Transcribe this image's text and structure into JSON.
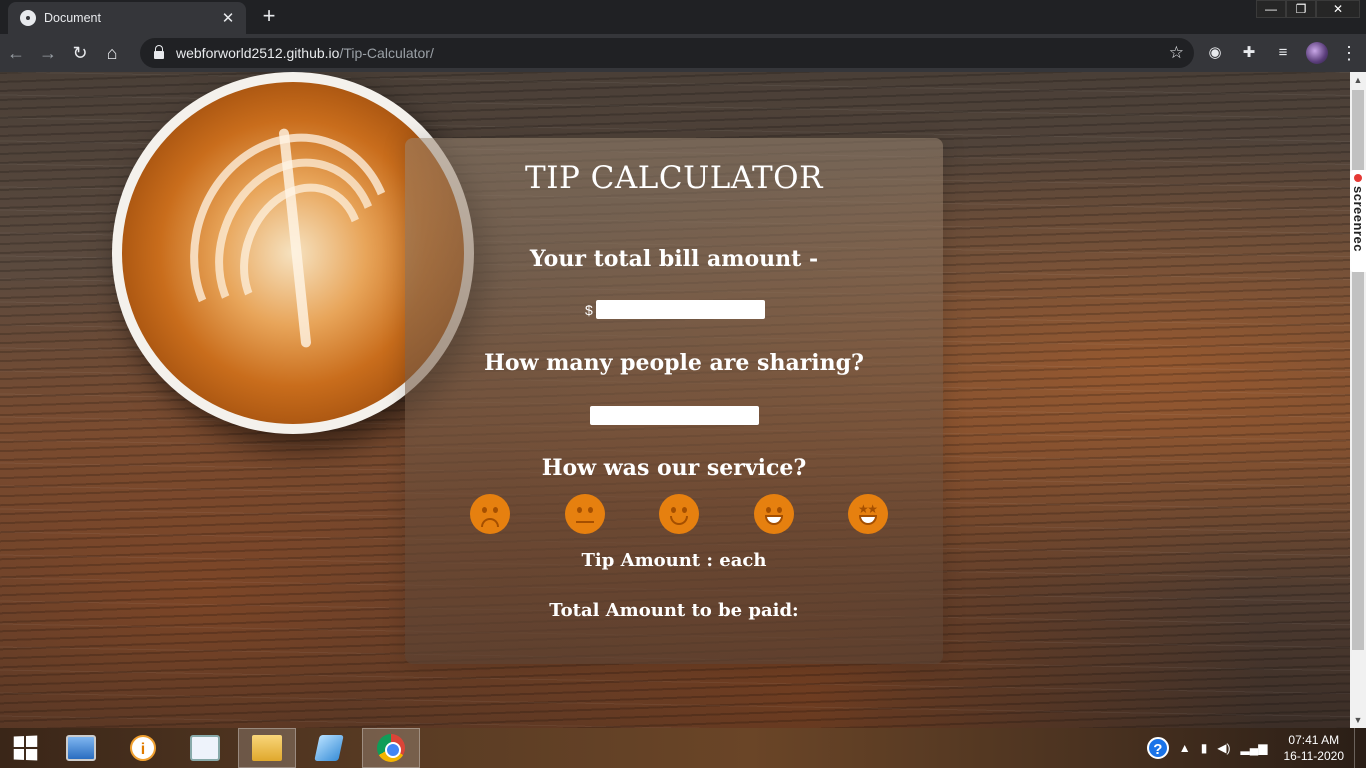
{
  "browser": {
    "tab_title": "Document",
    "tab_close": "✕",
    "new_tab": "+",
    "url_host": "webforworld2512.github.io",
    "url_path": "/Tip-Calculator/",
    "win_minimize": "—",
    "win_restore": "❐",
    "win_close": "✕"
  },
  "page": {
    "title": "TIP CALCULATOR",
    "bill_question": "Your total bill amount -",
    "currency_symbol": "$",
    "bill_value": "",
    "people_question": "How many people are sharing?",
    "people_value": "",
    "service_question": "How was our service?",
    "service_options": [
      "terrible",
      "neutral",
      "good",
      "great",
      "excellent"
    ],
    "tip_amount_text": "Tip Amount : each",
    "total_amount_text": "Total Amount to be paid:"
  },
  "colors": {
    "emoji": "#e6800f",
    "card_text": "#ffffff"
  },
  "overlay": {
    "screenrec_label": "screenrec"
  },
  "taskbar": {
    "info_glyph": "i",
    "help_glyph": "?",
    "clock_time": "07:41 AM",
    "clock_date": "16-11-2020"
  }
}
